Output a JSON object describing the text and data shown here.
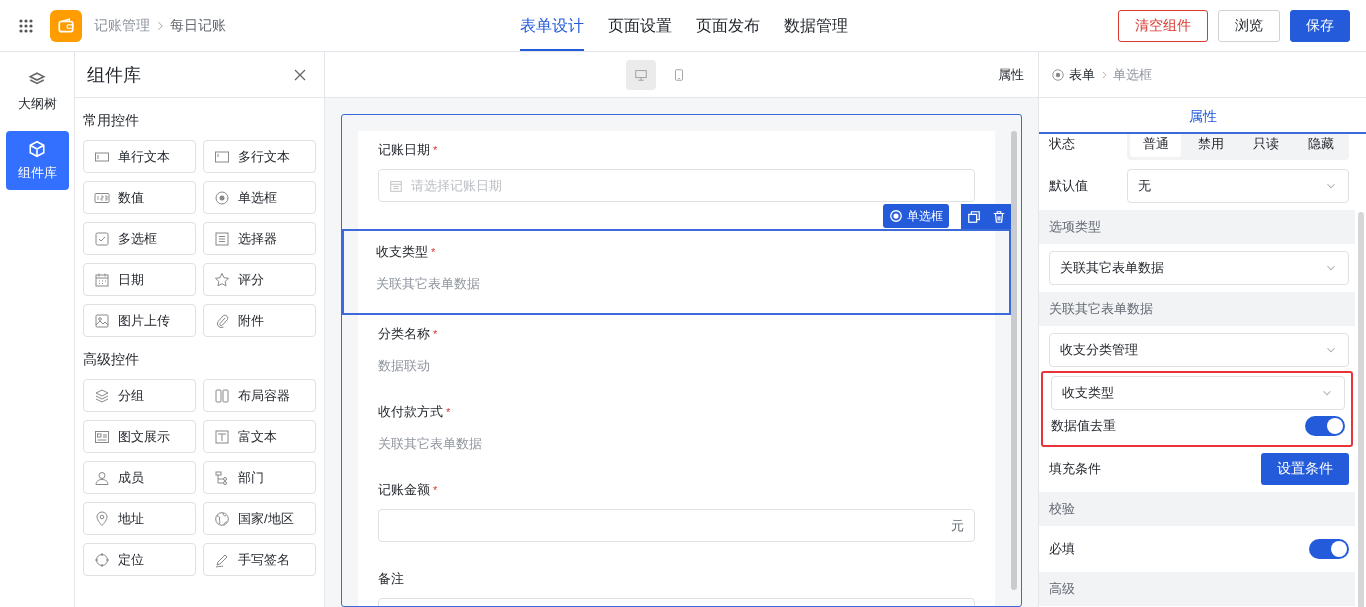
{
  "header": {
    "breadcrumb": [
      "记账管理",
      "每日记账"
    ],
    "tabs": [
      {
        "label": "表单设计",
        "selected": true
      },
      {
        "label": "页面设置",
        "selected": false
      },
      {
        "label": "页面发布",
        "selected": false
      },
      {
        "label": "数据管理",
        "selected": false
      }
    ],
    "buttons": [
      {
        "label": "清空组件",
        "kind": "danger"
      },
      {
        "label": "浏览",
        "kind": "default"
      },
      {
        "label": "保存",
        "kind": "primary"
      }
    ]
  },
  "rail": [
    {
      "label": "大纲树",
      "selected": false
    },
    {
      "label": "组件库",
      "selected": true
    }
  ],
  "library": {
    "title": "组件库",
    "groups": [
      {
        "title": "常用控件",
        "items": [
          "单行文本",
          "多行文本",
          "数值",
          "单选框",
          "多选框",
          "选择器",
          "日期",
          "评分",
          "图片上传",
          "附件"
        ]
      },
      {
        "title": "高级控件",
        "items": [
          "分组",
          "布局容器",
          "图文展示",
          "富文本",
          "成员",
          "部门",
          "地址",
          "国家/地区",
          "定位",
          "手写签名"
        ]
      }
    ]
  },
  "canvas": {
    "devices": [
      {
        "kind": "desktop",
        "selected": true
      },
      {
        "kind": "mobile",
        "selected": false
      }
    ],
    "right_label": "属性",
    "badge": "单选框",
    "fields": [
      {
        "label": "记账日期",
        "mark": "*",
        "kind": "date",
        "placeholder": "请选择记账日期",
        "selected": false
      },
      {
        "label": "收支类型",
        "mark": "*",
        "kind": "note",
        "text": "关联其它表单数据",
        "selected": true
      },
      {
        "label": "分类名称",
        "mark": "*",
        "kind": "note",
        "text": "数据联动",
        "selected": false
      },
      {
        "label": "收付款方式",
        "mark": "*",
        "kind": "note",
        "text": "关联其它表单数据",
        "selected": false
      },
      {
        "label": "记账金额",
        "mark": "*",
        "kind": "amount",
        "suffix": "元",
        "selected": false
      },
      {
        "label": "备注",
        "kind": "textarea",
        "selected": false
      }
    ]
  },
  "props": {
    "breadcrumb": [
      "表单",
      "单选框"
    ],
    "tab": {
      "label": "属性",
      "selected": true
    },
    "rows": [
      {
        "kind": "segmented",
        "label": "状态",
        "options": [
          {
            "label": "普通",
            "selected": true
          },
          {
            "label": "禁用",
            "selected": false
          },
          {
            "label": "只读",
            "selected": false
          },
          {
            "label": "隐藏",
            "selected": false
          }
        ]
      },
      {
        "kind": "select",
        "label": "默认值",
        "value": "无"
      },
      {
        "kind": "section",
        "label": "选项类型"
      },
      {
        "kind": "select",
        "value": "关联其它表单数据"
      },
      {
        "kind": "section",
        "label": "关联其它表单数据"
      },
      {
        "kind": "select",
        "value": "收支分类管理"
      },
      {
        "kind": "highlight",
        "children": [
          {
            "kind": "select",
            "value": "收支类型"
          },
          {
            "kind": "toggle",
            "label": "数据值去重",
            "on": true
          }
        ]
      },
      {
        "kind": "button",
        "label": "填充条件",
        "button": "设置条件"
      },
      {
        "kind": "section",
        "label": "校验"
      },
      {
        "kind": "toggle",
        "label": "必填",
        "on": true
      },
      {
        "kind": "section",
        "label": "高级"
      }
    ]
  }
}
